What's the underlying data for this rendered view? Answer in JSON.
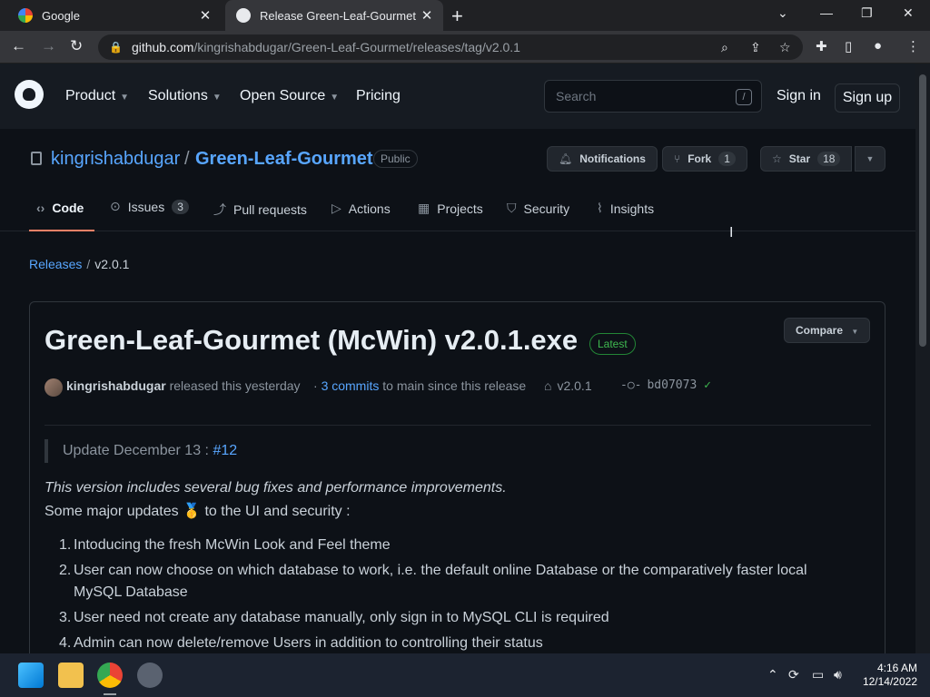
{
  "browser": {
    "tabs": [
      {
        "title": "Google"
      },
      {
        "title": "Release Green-Leaf-Gourmet (McWin) v2.0.1.exe"
      }
    ],
    "url_host": "github.com",
    "url_path": "/kingrishabdugar/Green-Leaf-Gourmet/releases/tag/v2.0.1"
  },
  "header": {
    "nav": [
      "Product",
      "Solutions",
      "Open Source",
      "Pricing"
    ],
    "search_placeholder": "Search",
    "search_shortcut": "/",
    "sign_in": "Sign in",
    "sign_up": "Sign up"
  },
  "repo": {
    "owner": "kingrishabdugar",
    "name": "Green-Leaf-Gourmet",
    "visibility": "Public",
    "notifications_label": "Notifications",
    "fork_label": "Fork",
    "fork_count": "1",
    "star_label": "Star",
    "star_count": "18",
    "tabs": [
      {
        "label": "Code",
        "icon": "code-icon"
      },
      {
        "label": "Issues",
        "icon": "issue-icon",
        "count": "3"
      },
      {
        "label": "Pull requests",
        "icon": "pull-request-icon"
      },
      {
        "label": "Actions",
        "icon": "play-icon"
      },
      {
        "label": "Projects",
        "icon": "table-icon"
      },
      {
        "label": "Security",
        "icon": "shield-icon"
      },
      {
        "label": "Insights",
        "icon": "graph-icon"
      }
    ]
  },
  "breadcrumb": {
    "root": "Releases",
    "current": "v2.0.1"
  },
  "release": {
    "title": "Green-Leaf-Gourmet (McWin) v2.0.1.exe",
    "badge": "Latest",
    "compare_label": "Compare",
    "author": "kingrishabdugar",
    "released_text": "released this yesterday",
    "commits_link": "3 commits",
    "commits_rest": "to main since this release",
    "tag": "v2.0.1",
    "commit": "bd07073",
    "quote_text": "Update December 13 :",
    "quote_link": "#12",
    "italic_line": "This version includes several bug fixes and performance improvements.",
    "major_line_a": "Some major updates",
    "major_emoji": "🥇",
    "major_line_b": "to the UI and security :",
    "items": [
      "Intoducing the fresh McWin Look and Feel theme",
      "User can now choose on which database to work, i.e. the default online Database or the comparatively faster local MySQL Database",
      "User need not create any database manually, only sign in to MySQL CLI is required",
      "Admin can now delete/remove Users in addition to controlling their status"
    ]
  },
  "taskbar": {
    "time": "4:16 AM",
    "date": "12/14/2022"
  },
  "colors": {
    "link": "#58a6ff",
    "accent_tab": "#f78166",
    "latest_green": "#3fb950",
    "bg": "#0d1117"
  }
}
